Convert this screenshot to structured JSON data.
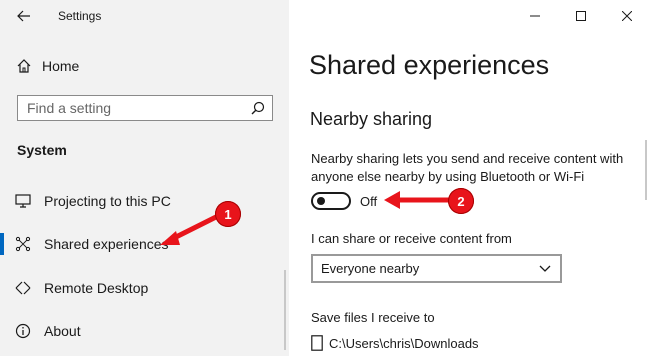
{
  "window": {
    "title": "Settings"
  },
  "sidebar": {
    "home_label": "Home",
    "search_placeholder": "Find a setting",
    "section_heading": "System",
    "items": [
      {
        "label": "Projecting to this PC",
        "icon": "projector-icon"
      },
      {
        "label": "Shared experiences",
        "icon": "shared-experiences-icon",
        "selected": true
      },
      {
        "label": "Remote Desktop",
        "icon": "remote-desktop-icon"
      },
      {
        "label": "About",
        "icon": "info-icon"
      }
    ]
  },
  "main": {
    "page_title": "Shared experiences",
    "nearby_heading": "Nearby sharing",
    "nearby_description": "Nearby sharing lets you send and receive content with anyone else nearby by using Bluetooth or Wi-Fi",
    "toggle_state_label": "Off",
    "share_from_label": "I can share or receive content from",
    "share_from_value": "Everyone nearby",
    "save_files_label": "Save files I receive to",
    "save_path": "C:\\Users\\chris\\Downloads"
  },
  "annotations": {
    "badge_1": "1",
    "badge_2": "2",
    "color": "#e8141b"
  },
  "colors": {
    "sidebar_bg": "#f2f2f2",
    "accent": "#0067c0"
  }
}
